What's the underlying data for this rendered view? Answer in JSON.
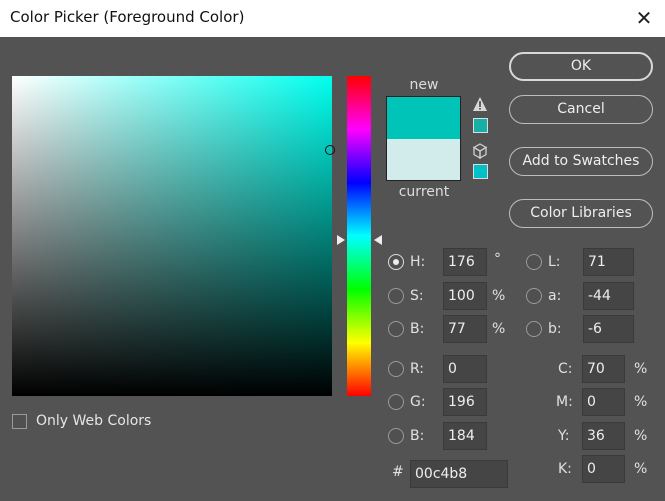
{
  "window": {
    "title": "Color Picker (Foreground Color)",
    "close_glyph": "✕"
  },
  "preview": {
    "new_label": "new",
    "current_label": "current",
    "new_color": "#00c4b8",
    "current_color": "#d2ecec"
  },
  "buttons": {
    "ok": "OK",
    "cancel": "Cancel",
    "add_to_swatches": "Add to Swatches",
    "color_libraries": "Color Libraries"
  },
  "icons": {
    "gamut_warning": "warning-triangle-icon",
    "web_safe": "cube-icon"
  },
  "hsb": {
    "h": {
      "label": "H:",
      "value": "176",
      "unit": "°"
    },
    "s": {
      "label": "S:",
      "value": "100",
      "unit": "%"
    },
    "b": {
      "label": "B:",
      "value": "77",
      "unit": "%"
    }
  },
  "rgb": {
    "r": {
      "label": "R:",
      "value": "0"
    },
    "g": {
      "label": "G:",
      "value": "196"
    },
    "b": {
      "label": "B:",
      "value": "184"
    }
  },
  "lab": {
    "l": {
      "label": "L:",
      "value": "71"
    },
    "a": {
      "label": "a:",
      "value": "-44"
    },
    "b": {
      "label": "b:",
      "value": "-6"
    }
  },
  "cmyk": {
    "c": {
      "label": "C:",
      "value": "70",
      "unit": "%"
    },
    "m": {
      "label": "M:",
      "value": "0",
      "unit": "%"
    },
    "y": {
      "label": "Y:",
      "value": "36",
      "unit": "%"
    },
    "k": {
      "label": "K:",
      "value": "0",
      "unit": "%"
    }
  },
  "hex": {
    "label": "#",
    "value": "00c4b8"
  },
  "only_web_colors": {
    "label": "Only Web Colors",
    "checked": false
  },
  "selected_channel": "H"
}
